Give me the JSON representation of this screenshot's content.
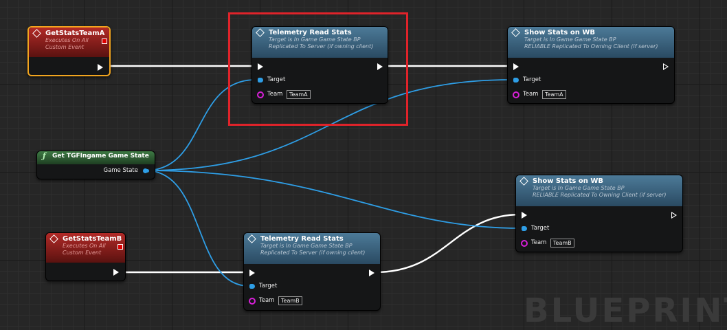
{
  "watermark": "BLUEPRINT",
  "colors": {
    "exec_wire": "#ffffff",
    "object_wire": "#2e9ee6",
    "team_pin": "#d81fd8",
    "selection": "#f2a51f",
    "highlight_box": "#e0232a"
  },
  "events": [
    {
      "title": "GetStatsTeamA",
      "subtitle1": "Executes On All",
      "subtitle2": "Custom Event"
    },
    {
      "title": "GetStatsTeamB",
      "subtitle1": "Executes On All",
      "subtitle2": "Custom Event"
    }
  ],
  "get_state": {
    "title": "Get TGFIngame Game State",
    "icon": "function-icon",
    "output_label": "Game State"
  },
  "telemetry": [
    {
      "title": "Telemetry Read Stats",
      "subtitle1": "Target is In Game Game State BP",
      "subtitle2": "Replicated To Server (if owning client)",
      "target_label": "Target",
      "team_label": "Team",
      "team_value": "TeamA"
    },
    {
      "title": "Telemetry Read Stats",
      "subtitle1": "Target is In Game Game State BP",
      "subtitle2": "Replicated To Server (if owning client)",
      "target_label": "Target",
      "team_label": "Team",
      "team_value": "TeamB"
    }
  ],
  "show_stats": [
    {
      "title": "Show Stats on WB",
      "subtitle1": "Target is In Game Game State BP",
      "subtitle2": "RELIABLE Replicated To Owning Client (if server)",
      "target_label": "Target",
      "team_label": "Team",
      "team_value": "TeamA"
    },
    {
      "title": "Show Stats on WB",
      "subtitle1": "Target is In Game Game State BP",
      "subtitle2": "RELIABLE Replicated To Owning Client (if server)",
      "target_label": "Target",
      "team_label": "Team",
      "team_value": "TeamB"
    }
  ]
}
